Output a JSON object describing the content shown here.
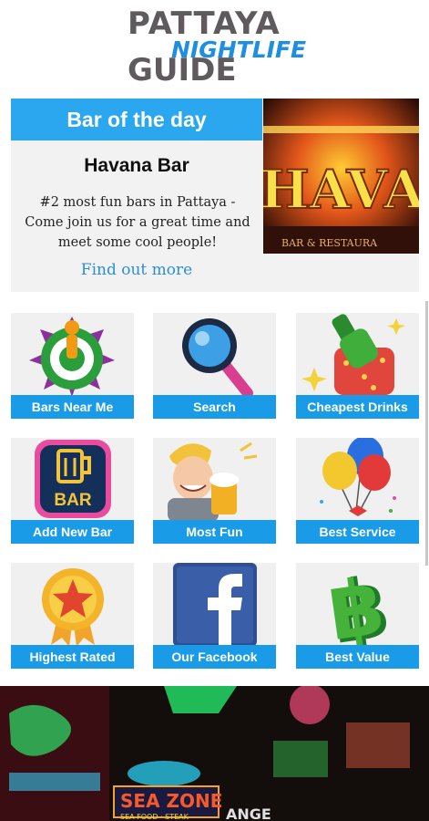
{
  "header": {
    "logo_line1": "PATTAYA",
    "logo_line2": "NIGHTLIFE",
    "logo_line3": "GUIDE"
  },
  "bar_of_the_day": {
    "heading": "Bar of the day",
    "name": "Havana Bar",
    "description": "#2 most fun bars in Pattaya - Come join us for a great time and meet some cool people!",
    "link_label": "Find out more",
    "image_sign_text": "HAVAN",
    "image_sub_text": "BAR & RESTAURA"
  },
  "menu": {
    "items": [
      {
        "label": "Bars Near Me",
        "icon": "target-person-icon"
      },
      {
        "label": "Search",
        "icon": "magnifier-icon"
      },
      {
        "label": "Cheapest Drinks",
        "icon": "bottle-icon"
      },
      {
        "label": "Add New Bar",
        "icon": "beer-badge-icon"
      },
      {
        "label": "Most Fun",
        "icon": "party-man-icon"
      },
      {
        "label": "Best Service",
        "icon": "balloons-icon"
      },
      {
        "label": "Highest Rated",
        "icon": "star-medal-icon"
      },
      {
        "label": "Our Facebook",
        "icon": "facebook-icon"
      },
      {
        "label": "Best Value",
        "icon": "baht-icon"
      }
    ],
    "add_bar_badge_text": "BAR"
  },
  "banner": {
    "sign_text": "SEA ZONE",
    "sign_sub_text": "SEA FOOD · STEAK",
    "partial_text": "ANGE"
  },
  "colors": {
    "accent_blue": "#1a9be8",
    "header_blue": "#2aa7ef",
    "link_blue": "#2a8fd8",
    "logo_gray": "#5e5a5d"
  }
}
